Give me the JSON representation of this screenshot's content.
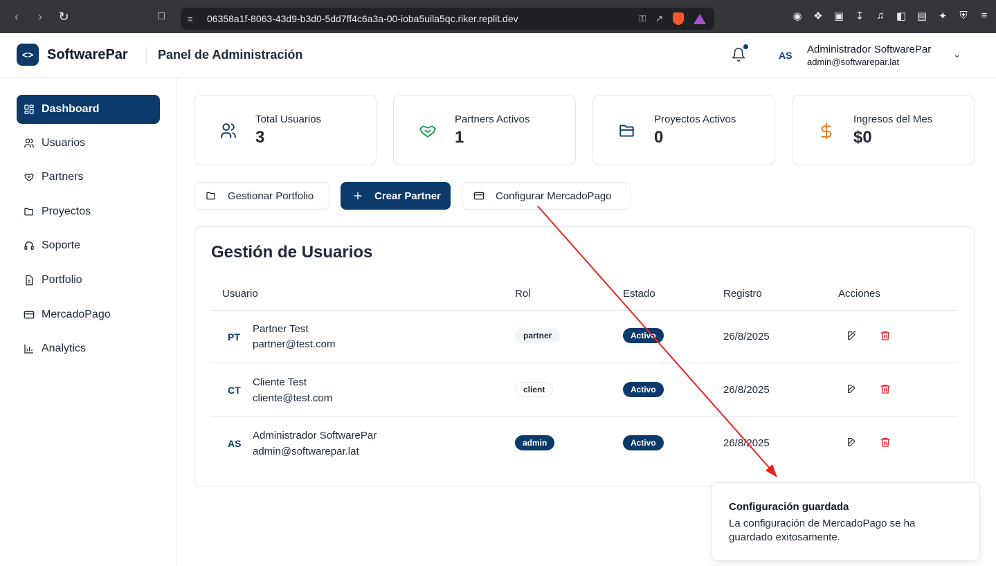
{
  "browser": {
    "url": "06358a1f-8063-43d9-b3d0-5dd7ff4c6a3a-00-ioba5uila5qc.riker.replit.dev"
  },
  "header": {
    "logo_glyph": "<>",
    "brand": "SoftwarePar",
    "panel_title": "Panel de Administración",
    "user_initials": "AS",
    "user_name": "Administrador SoftwarePar",
    "user_email": "admin@softwarepar.lat"
  },
  "sidebar": {
    "items": [
      {
        "label": "Dashboard",
        "icon": "grid-icon",
        "active": true
      },
      {
        "label": "Usuarios",
        "icon": "users-icon"
      },
      {
        "label": "Partners",
        "icon": "handshake-icon"
      },
      {
        "label": "Proyectos",
        "icon": "folder-icon"
      },
      {
        "label": "Soporte",
        "icon": "headset-icon"
      },
      {
        "label": "Portfolio",
        "icon": "file-icon"
      },
      {
        "label": "MercadoPago",
        "icon": "card-icon"
      },
      {
        "label": "Analytics",
        "icon": "bar-chart-icon"
      }
    ]
  },
  "stats": [
    {
      "label": "Total Usuarios",
      "value": "3",
      "icon": "users-icon",
      "color": "#0b3a6b"
    },
    {
      "label": "Partners Activos",
      "value": "1",
      "icon": "handshake-icon",
      "color": "#16a34a"
    },
    {
      "label": "Proyectos Activos",
      "value": "0",
      "icon": "folder-icon",
      "color": "#0b3a6b"
    },
    {
      "label": "Ingresos del Mes",
      "value": "$0",
      "icon": "dollar-icon",
      "color": "#ea7a1c"
    }
  ],
  "actions": {
    "portfolio": "Gestionar Portfolio",
    "create_partner": "Crear Partner",
    "mercadopago": "Configurar MercadoPago"
  },
  "users": {
    "title": "Gestión de Usuarios",
    "columns": [
      "Usuario",
      "Rol",
      "Estado",
      "Registro",
      "Acciones"
    ],
    "rows": [
      {
        "initials": "PT",
        "name": "Partner Test",
        "email": "partner@test.com",
        "role": "partner",
        "status": "Activo",
        "date": "26/8/2025"
      },
      {
        "initials": "CT",
        "name": "Cliente Test",
        "email": "cliente@test.com",
        "role": "client",
        "status": "Activo",
        "date": "26/8/2025"
      },
      {
        "initials": "AS",
        "name": "Administrador SoftwarePar",
        "email": "admin@softwarepar.lat",
        "role": "admin",
        "status": "Activo",
        "date": "26/8/2025"
      }
    ]
  },
  "toast": {
    "title": "Configuración guardada",
    "message": "La configuración de MercadoPago se ha guardado exitosamente."
  },
  "colors": {
    "primary": "#0b3a6b",
    "danger": "#dc2626",
    "annotation_arrow": "#e8231f"
  }
}
